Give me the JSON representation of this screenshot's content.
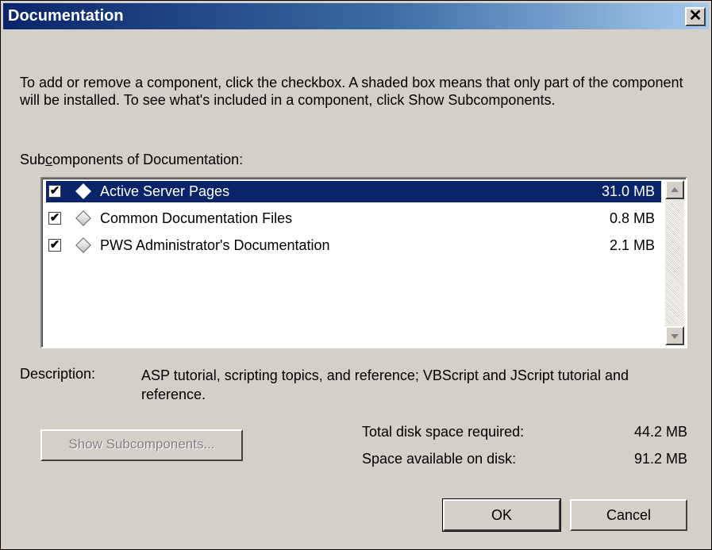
{
  "window": {
    "title": "Documentation",
    "close_label": "✕"
  },
  "intro": "To add or remove a component, click the checkbox. A shaded box means that only part of the component will be installed. To see what's included in a component, click Show Subcomponents.",
  "subcomponents": {
    "heading_pre": "Sub",
    "heading_accel": "c",
    "heading_post": "omponents of Documentation:",
    "items": [
      {
        "label": "Active Server Pages",
        "size": "31.0 MB",
        "checked": true,
        "selected": true
      },
      {
        "label": "Common Documentation Files",
        "size": "0.8 MB",
        "checked": true,
        "selected": false
      },
      {
        "label": "PWS Administrator's Documentation",
        "size": "2.1 MB",
        "checked": true,
        "selected": false
      }
    ]
  },
  "description": {
    "label": "Description:",
    "text": "ASP tutorial, scripting topics, and reference; VBScript and JScript tutorial and reference."
  },
  "buttons": {
    "show_subcomponents": "Show Subcomponents...",
    "ok": "OK",
    "cancel": "Cancel"
  },
  "disk": {
    "total_label": "Total disk space required:",
    "total_value": "44.2 MB",
    "available_label": "Space available on disk:",
    "available_value": "91.2 MB"
  },
  "colors": {
    "titlebar_start": "#0a246a",
    "selection": "#0a246a",
    "face": "#d4d0c8"
  }
}
